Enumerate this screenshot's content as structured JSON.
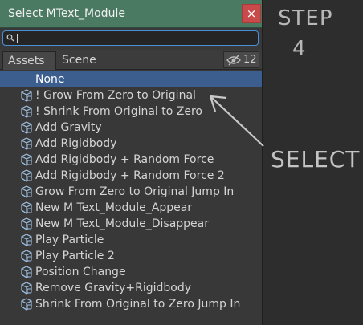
{
  "window": {
    "title": "Select MText_Module",
    "close_symbol": "×"
  },
  "search": {
    "value": "",
    "placeholder": ""
  },
  "tabs": [
    {
      "label": "Assets",
      "active": true
    },
    {
      "label": "Scene",
      "active": false
    }
  ],
  "hidden_counter": {
    "icon": "eye-slash-icon",
    "value": "12"
  },
  "items": [
    {
      "label": "None",
      "selected": true,
      "icon": ""
    },
    {
      "label": "! Grow From Zero to Original",
      "selected": false,
      "icon": "prefab-cube-icon"
    },
    {
      "label": "! Shrink From Original to Zero",
      "selected": false,
      "icon": "prefab-cube-icon"
    },
    {
      "label": "Add Gravity",
      "selected": false,
      "icon": "prefab-cube-icon"
    },
    {
      "label": "Add Rigidbody",
      "selected": false,
      "icon": "prefab-cube-icon"
    },
    {
      "label": "Add Rigidbody + Random Force",
      "selected": false,
      "icon": "prefab-cube-icon"
    },
    {
      "label": "Add Rigidbody + Random Force 2",
      "selected": false,
      "icon": "prefab-cube-icon"
    },
    {
      "label": "Grow From Zero to Original Jump In",
      "selected": false,
      "icon": "prefab-cube-icon"
    },
    {
      "label": "New M Text_Module_Appear",
      "selected": false,
      "icon": "prefab-cube-icon"
    },
    {
      "label": "New M Text_Module_Disappear",
      "selected": false,
      "icon": "prefab-cube-icon"
    },
    {
      "label": "Play Particle",
      "selected": false,
      "icon": "prefab-cube-icon"
    },
    {
      "label": "Play Particle 2",
      "selected": false,
      "icon": "prefab-cube-icon"
    },
    {
      "label": "Position Change",
      "selected": false,
      "icon": "prefab-cube-icon"
    },
    {
      "label": "Remove Gravity+Rigidbody",
      "selected": false,
      "icon": "prefab-cube-icon"
    },
    {
      "label": "Shrink From Original to Zero Jump In",
      "selected": false,
      "icon": "prefab-cube-icon"
    }
  ],
  "annotation": {
    "step_word": "STEP",
    "step_number": "4",
    "select_word": "SELECT"
  },
  "colors": {
    "titlebar": "#4b7a63",
    "selection": "#3b5e8f",
    "close": "#c94a4a",
    "search_focus": "#4a90d9"
  }
}
